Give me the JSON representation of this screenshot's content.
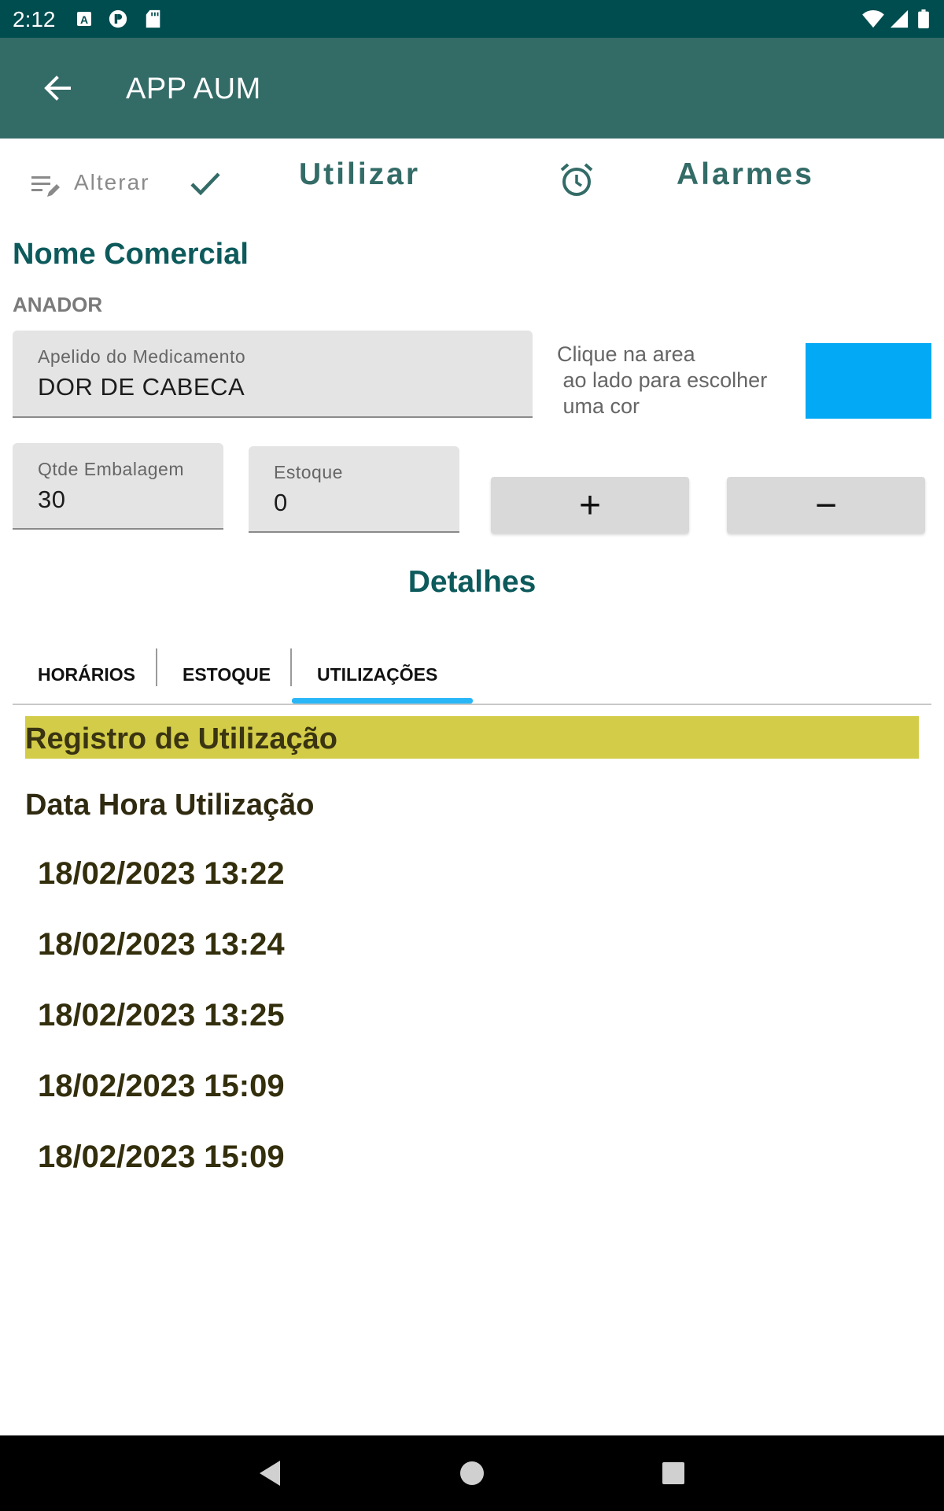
{
  "status_bar": {
    "time": "2:12",
    "left_icons": [
      "a-notification-icon",
      "p-notification-icon",
      "sd-card-icon"
    ],
    "right_icons": [
      "wifi-icon",
      "signal-icon",
      "battery-icon"
    ]
  },
  "app_bar": {
    "title": "APP AUM",
    "back_icon": "arrow-back-icon"
  },
  "toolbar": {
    "alterar_label": "Alterar",
    "alterar_icon": "edit-list-icon",
    "confirm_icon": "check-icon",
    "utilizar_label": "Utilizar",
    "alarm_icon": "alarm-clock-icon",
    "alarmes_label": "Alarmes"
  },
  "medication": {
    "heading": "Nome Comercial",
    "commercial_name": "ANADOR",
    "nickname_label": "Apelido do Medicamento",
    "nickname_value": "DOR DE CABECA",
    "color_hint": "Clique na area\n ao lado para escolher\n uma cor",
    "color": "#03a9f4",
    "package_qty_label": "Qtde Embalagem",
    "package_qty_value": "30",
    "stock_label": "Estoque",
    "stock_value": "0",
    "plus_label": "+",
    "minus_label": "−"
  },
  "details": {
    "heading": "Detalhes",
    "tabs": [
      {
        "label": "HORÁRIOS",
        "selected": false
      },
      {
        "label": "ESTOQUE",
        "selected": false
      },
      {
        "label": "UTILIZAÇÕES",
        "selected": true
      }
    ],
    "accent": "#29b6f6"
  },
  "usage": {
    "banner_title": "Registro de Utilização",
    "banner_color": "#d2cc48",
    "column_header": "Data Hora Utilização",
    "rows": [
      "18/02/2023 13:22",
      "18/02/2023 13:24",
      "18/02/2023 13:25",
      "18/02/2023 15:09",
      "18/02/2023 15:09"
    ]
  },
  "nav_bar": {
    "icons": [
      "back-triangle-icon",
      "home-circle-icon",
      "recents-square-icon"
    ]
  }
}
